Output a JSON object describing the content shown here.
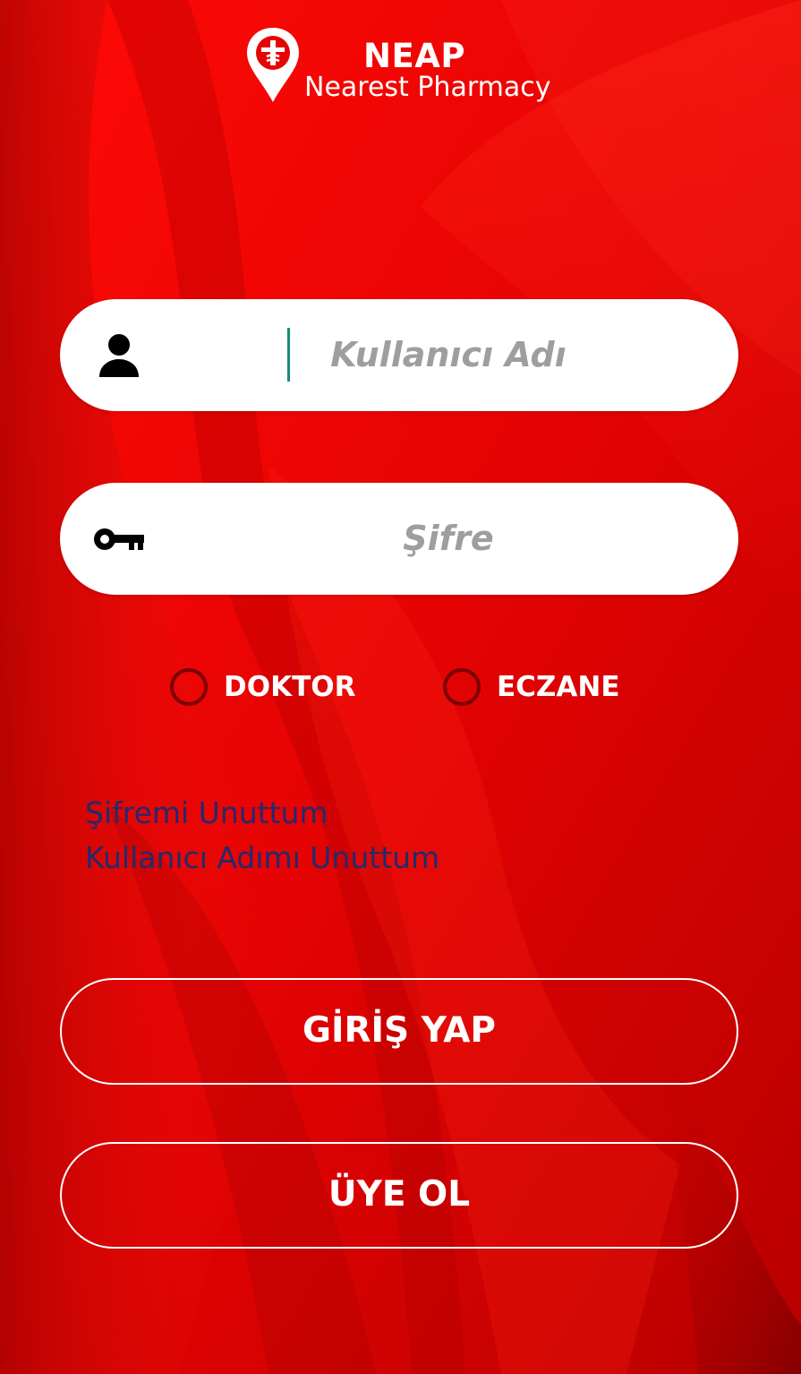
{
  "app": {
    "title": "NEAP",
    "subtitle": "Nearest Pharmacy"
  },
  "colors": {
    "background": "#e80404",
    "link": "#232a6e",
    "placeholder": "#9e9e9e",
    "radio_ring": "#7a0000"
  },
  "form": {
    "username": {
      "placeholder": "Kullanıcı Adı",
      "value": "",
      "icon": "person-icon"
    },
    "password": {
      "placeholder": "Şifre",
      "value": "",
      "icon": "key-icon"
    },
    "role": {
      "options": [
        "DOKTOR",
        "ECZANE"
      ],
      "selected": null
    }
  },
  "links": {
    "forgot_password": "Şifremi Unuttum",
    "forgot_username": "Kullanıcı Adımı Unuttum"
  },
  "buttons": {
    "login": "GİRİŞ YAP",
    "register": "ÜYE OL"
  }
}
